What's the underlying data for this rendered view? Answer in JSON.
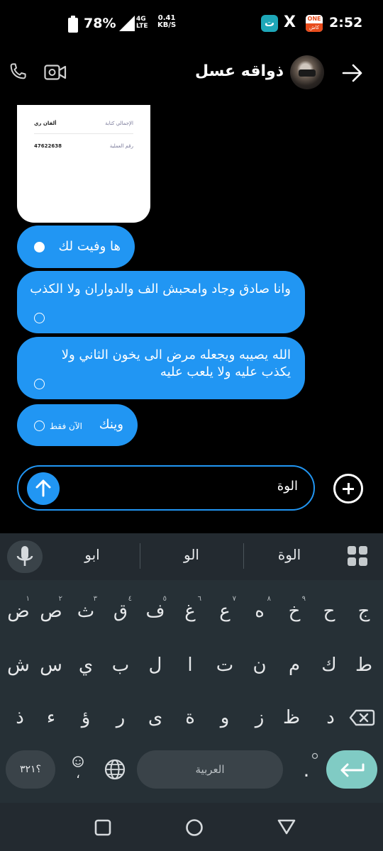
{
  "status_bar": {
    "battery": "78%",
    "network": [
      "4G",
      "LTE"
    ],
    "speed": [
      "0.41",
      "KB/S"
    ],
    "app1_glyph": "ت",
    "x_glyph": "X",
    "app2_top": "ONE",
    "app2_bottom": "كاش",
    "time": "2:52"
  },
  "header": {
    "contact_name": "ذواقه عسل",
    "icons": [
      "call-icon",
      "video-call-icon",
      "back-arrow-icon"
    ]
  },
  "image_card": {
    "row1_label": "الإجمالي كتابة",
    "row1_value": "ألفان ري",
    "row2_label": "رقم العملية",
    "row2_value": "47622638"
  },
  "messages": [
    {
      "text": "ها وفيت لك",
      "status": "read"
    },
    {
      "text": "وانا صادق وجاد وامحبش الف والدواران ولا الكذب",
      "status": "sent"
    },
    {
      "text": "الله يصيبه ويجعله مرض الى يخون الثاني ولا يكذب عليه ولا يلعب عليه",
      "status": "sent"
    },
    {
      "text": "وينك",
      "time": "الآن فقط",
      "status": "sent"
    }
  ],
  "composer": {
    "value": "الوة"
  },
  "keyboard": {
    "suggestions": [
      "الوة",
      "الو",
      "ابو"
    ],
    "row1": [
      {
        "k": "ج",
        "h": ""
      },
      {
        "k": "ح",
        "h": ""
      },
      {
        "k": "خ",
        "h": "٩"
      },
      {
        "k": "ه",
        "h": "٨"
      },
      {
        "k": "ع",
        "h": "٧"
      },
      {
        "k": "غ",
        "h": "٦"
      },
      {
        "k": "ف",
        "h": "٥"
      },
      {
        "k": "ق",
        "h": "٤"
      },
      {
        "k": "ث",
        "h": "٣"
      },
      {
        "k": "ص",
        "h": "٢"
      },
      {
        "k": "ض",
        "h": "١"
      }
    ],
    "row2": [
      "ط",
      "ك",
      "م",
      "ن",
      "ت",
      "ا",
      "ل",
      "ب",
      "ي",
      "س",
      "ش"
    ],
    "row3": [
      "د",
      "ظ",
      "ز",
      "و",
      "ة",
      "ى",
      "ر",
      "ؤ",
      "ء",
      "ذ"
    ],
    "numbers_key": "؟٣٢١",
    "emoji_key_comma": "،",
    "space_label": "العربية",
    "period_key": "."
  },
  "colors": {
    "bubble": "#2196f3",
    "keyboard_bg": "#263036",
    "enter_key": "#80cbc4"
  }
}
